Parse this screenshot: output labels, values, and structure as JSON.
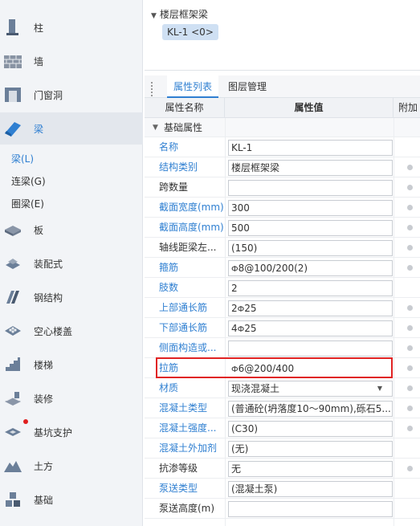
{
  "sidebar": {
    "items": [
      {
        "label": "柱",
        "icon": "column-icon"
      },
      {
        "label": "墙",
        "icon": "wall-icon"
      },
      {
        "label": "门窗洞",
        "icon": "door-window-icon"
      },
      {
        "label": "梁",
        "icon": "beam-icon",
        "active": true
      },
      {
        "label": "板",
        "icon": "slab-icon"
      },
      {
        "label": "装配式",
        "icon": "prefab-icon"
      },
      {
        "label": "钢结构",
        "icon": "steel-structure-icon"
      },
      {
        "label": "空心楼盖",
        "icon": "hollow-floor-icon"
      },
      {
        "label": "楼梯",
        "icon": "stair-icon"
      },
      {
        "label": "装修",
        "icon": "decoration-icon"
      },
      {
        "label": "基坑支护",
        "icon": "foundation-pit-icon"
      },
      {
        "label": "土方",
        "icon": "earthwork-icon"
      },
      {
        "label": "基础",
        "icon": "foundation-icon"
      }
    ],
    "sub_items": [
      "梁(L)",
      "连梁(G)",
      "圈梁(E)"
    ]
  },
  "tree": {
    "title": "楼层框架梁",
    "chip": "KL-1 <0>"
  },
  "tabs": [
    "属性列表",
    "图层管理"
  ],
  "grid": {
    "headers": {
      "name": "属性名称",
      "value": "属性值",
      "add": "附加"
    },
    "section": "基础属性",
    "rows": [
      {
        "name": "名称",
        "value": "KL-1",
        "style": "blue",
        "dot": false
      },
      {
        "name": "结构类别",
        "value": "楼层框架梁",
        "style": "blue",
        "dot": true
      },
      {
        "name": "跨数量",
        "value": "",
        "style": "dark",
        "dot": true
      },
      {
        "name": "截面宽度(mm)",
        "value": "300",
        "style": "blue",
        "dot": true
      },
      {
        "name": "截面高度(mm)",
        "value": "500",
        "style": "blue",
        "dot": true
      },
      {
        "name": "轴线距梁左...",
        "value": "(150)",
        "style": "dark",
        "dot": true
      },
      {
        "name": "箍筋",
        "value": "8@100/200(2)",
        "style": "blue",
        "dot": true,
        "rebar": "Ф"
      },
      {
        "name": "肢数",
        "value": "2",
        "style": "blue",
        "dot": false
      },
      {
        "name": "上部通长筋",
        "value": "25",
        "prefix": "2",
        "style": "blue",
        "dot": true,
        "rebar": "Ф"
      },
      {
        "name": "下部通长筋",
        "value": "25",
        "prefix": "4",
        "style": "blue",
        "dot": true,
        "rebar": "Ф"
      },
      {
        "name": "侧面构造或...",
        "value": "",
        "style": "blue",
        "dot": true
      },
      {
        "name": "拉筋",
        "value": "6@200/400",
        "style": "blue",
        "dot": true,
        "rebar": "Ф"
      },
      {
        "name": "材质",
        "value": "现浇混凝土",
        "style": "blue",
        "dot": true,
        "dropdown": true
      },
      {
        "name": "混凝土类型",
        "value": "(普通砼(坍落度10～90mm),砾石5...",
        "style": "blue",
        "dot": true
      },
      {
        "name": "混凝土强度...",
        "value": "(C30)",
        "style": "blue",
        "dot": true
      },
      {
        "name": "混凝土外加剂",
        "value": "(无)",
        "style": "blue",
        "dot": false
      },
      {
        "name": "抗渗等级",
        "value": "无",
        "style": "dark",
        "dot": true
      },
      {
        "name": "泵送类型",
        "value": "(混凝土泵)",
        "style": "blue",
        "dot": false
      },
      {
        "name": "泵送高度(m)",
        "value": "",
        "style": "dark",
        "dot": false
      }
    ]
  }
}
